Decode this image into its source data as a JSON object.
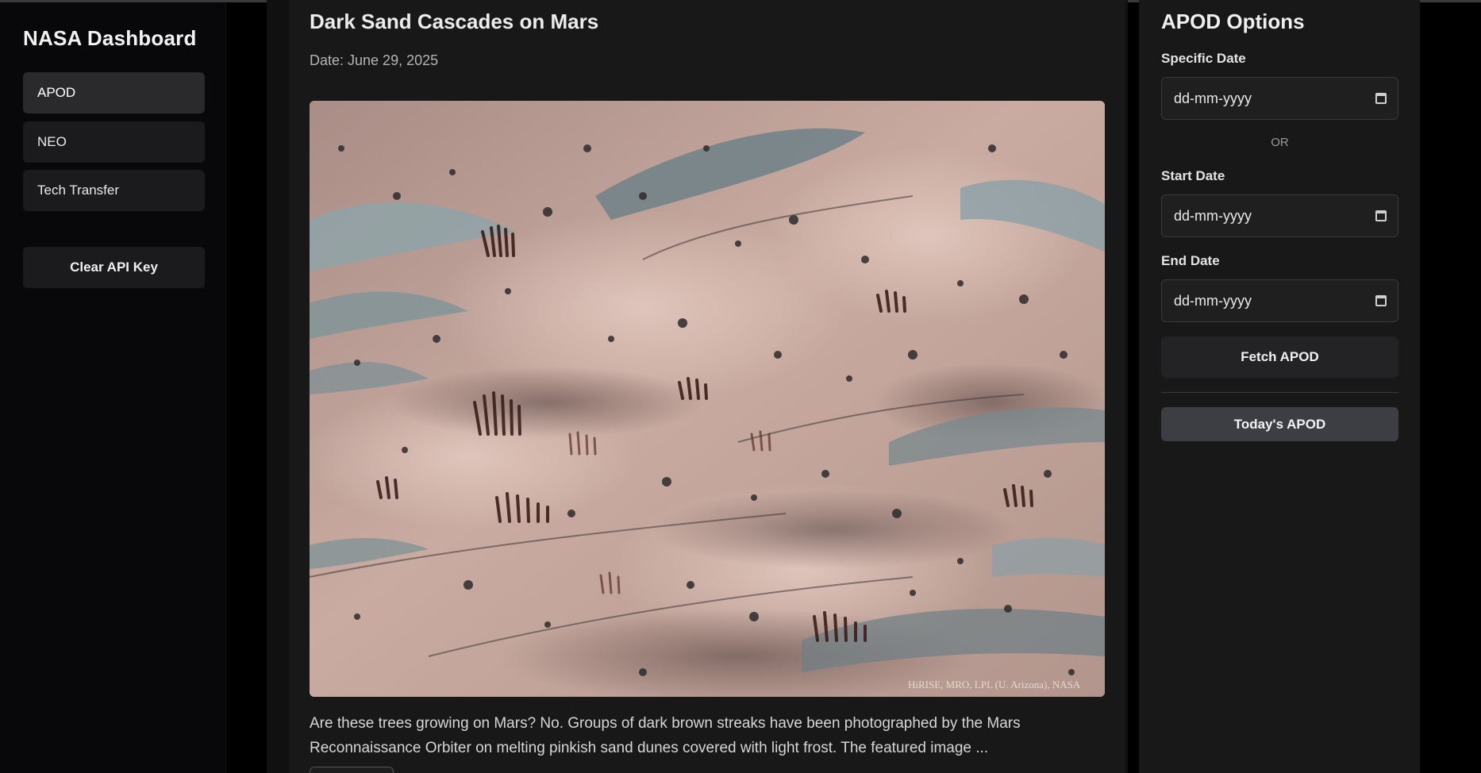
{
  "sidebar": {
    "brand": "NASA Dashboard",
    "items": [
      {
        "label": "APOD",
        "active": true
      },
      {
        "label": "NEO",
        "active": false
      },
      {
        "label": "Tech Transfer",
        "active": false
      }
    ],
    "clear_api_key": "Clear API Key"
  },
  "apod": {
    "title": "Dark Sand Cascades on Mars",
    "date": "Date: June 29, 2025",
    "image_credit": "HiRISE, MRO, LPL (U. Arizona), NASA",
    "explanation": "Are these trees growing on Mars? No. Groups of dark brown streaks have been photographed by the Mars Reconnaissance Orbiter on melting pinkish sand dunes covered with light frost. The featured image ..."
  },
  "options": {
    "title": "APOD Options",
    "specific_date_label": "Specific Date",
    "specific_date_placeholder": "dd-mm-yyyy",
    "or_text": "OR",
    "start_date_label": "Start Date",
    "start_date_placeholder": "dd-mm-yyyy",
    "end_date_label": "End Date",
    "end_date_placeholder": "dd-mm-yyyy",
    "fetch_button": "Fetch APOD",
    "today_button": "Today's APOD"
  },
  "colors": {
    "background": "#000000",
    "sidebar": "#08080a",
    "card": "#181818",
    "button": "#1b1b1d",
    "accent_button": "#3d3d44",
    "sand": "#c4a49a",
    "frost": "#9fb8bf"
  },
  "icons": {
    "date_picker": "calendar-icon"
  }
}
